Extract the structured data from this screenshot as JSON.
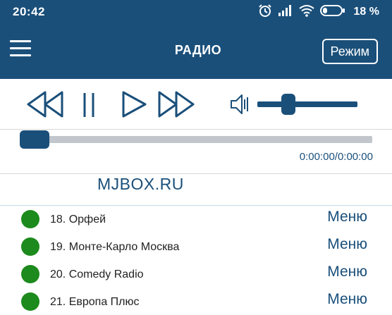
{
  "status_bar": {
    "time": "20:42",
    "battery_percent": "18 %",
    "icons": [
      "alarm-icon",
      "signal-icon",
      "wifi-icon",
      "battery-icon"
    ]
  },
  "app_bar": {
    "title": "РАДИО",
    "mode_button_label": "Режим",
    "menu_icon": "hamburger-menu-icon"
  },
  "player": {
    "buttons": [
      "rewind-icon",
      "pause-icon",
      "play-icon",
      "fast-forward-icon"
    ],
    "volume_icon": "speaker-icon",
    "volume_level": 0.28,
    "seek_position": 0.0,
    "time_readout": "0:00:00/0:00:00"
  },
  "site": {
    "name": "MJBOX.RU"
  },
  "stations": [
    {
      "label": "18. Орфей",
      "menu_label": "Меню"
    },
    {
      "label": "19. Монте-Карло Москва",
      "menu_label": "Меню"
    },
    {
      "label": "20. Comedy Radio",
      "menu_label": "Меню"
    },
    {
      "label": "21. Европа Плюс",
      "menu_label": "Меню"
    }
  ],
  "colors": {
    "primary": "#1a4f7a",
    "status_online": "#1c8a1c",
    "track": "#c0c6cb"
  }
}
